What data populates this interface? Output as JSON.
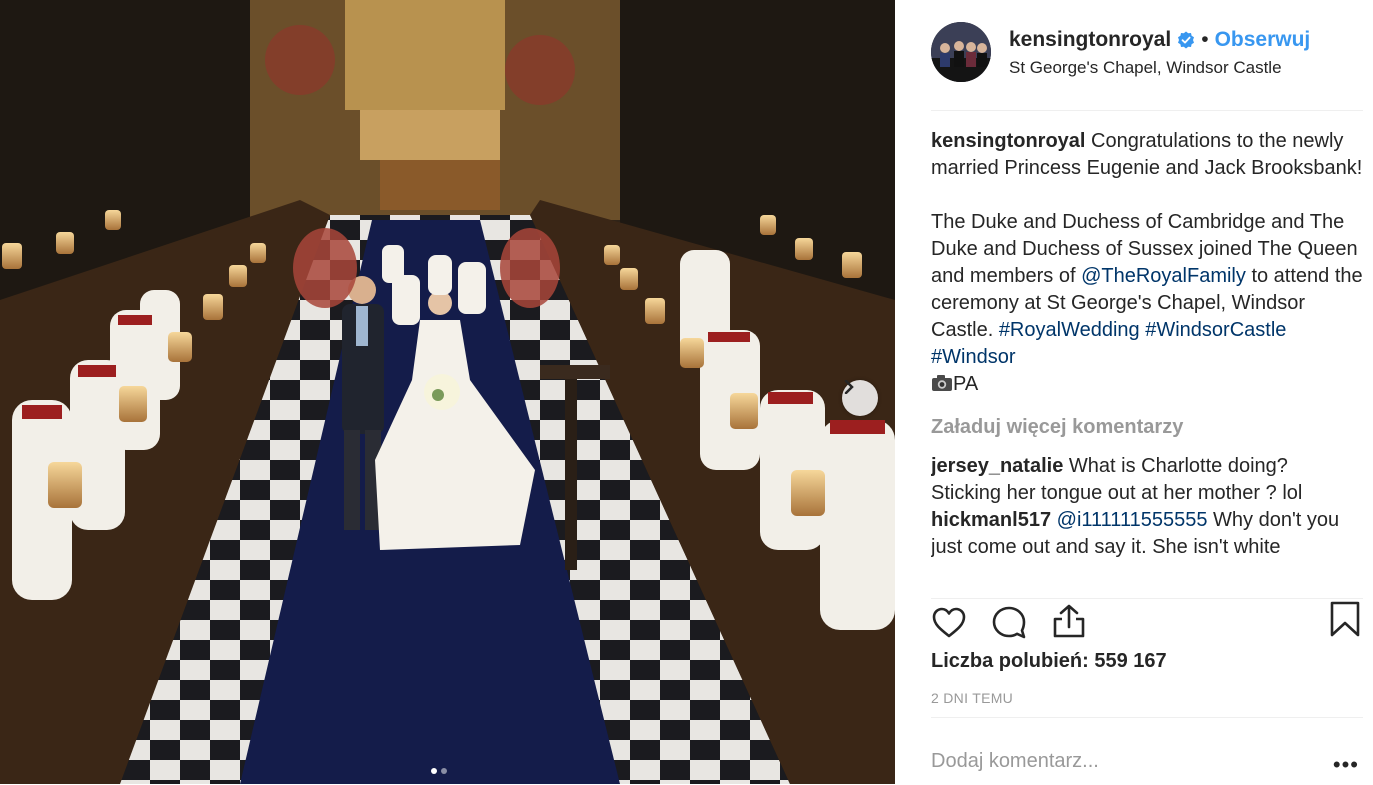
{
  "post": {
    "username": "kensingtonroyal",
    "separator": "•",
    "follow_label": "Obserwuj",
    "location": "St George's Chapel, Windsor Castle"
  },
  "caption": {
    "username": "kensingtonroyal",
    "text1": "Congratulations to the newly married Princess Eugenie and Jack Brooksbank!",
    "text2a": "The Duke and Duchess of Cambridge and The Duke and Duchess of Sussex joined The Queen and members of",
    "mention": "@TheRoyalFamily",
    "text2b": "to attend the ceremony at St George's Chapel, Windsor Castle.",
    "hashtags": [
      "#RoyalWedding",
      "#WindsorCastle",
      "#Windsor"
    ],
    "credit_icon": "camera-emoji",
    "credit": "PA"
  },
  "load_more_label": "Załaduj więcej komentarzy",
  "comments": [
    {
      "username": "jersey_natalie",
      "text": "What is Charlotte doing? Sticking her tongue out at her mother ? lol"
    },
    {
      "username": "hickmanl517",
      "mention": "@i111111555555",
      "text": "Why don't you just come out and say it. She isn't white"
    }
  ],
  "likes": {
    "label": "Liczba polubień:",
    "count": "559 167"
  },
  "timestamp": "2 DNI TEMU",
  "add_comment_placeholder": "Dodaj komentarz...",
  "more_label": "•••",
  "icons": {
    "like": "heart-icon",
    "comment": "comment-icon",
    "share": "share-icon",
    "save": "bookmark-icon",
    "verified": "verified-badge-icon",
    "next": "chevron-right-icon"
  },
  "colors": {
    "link": "#003569",
    "follow": "#3897f0",
    "verified": "#3897f0",
    "muted": "#999999"
  },
  "carousel": {
    "slides": 2,
    "active": 1
  }
}
